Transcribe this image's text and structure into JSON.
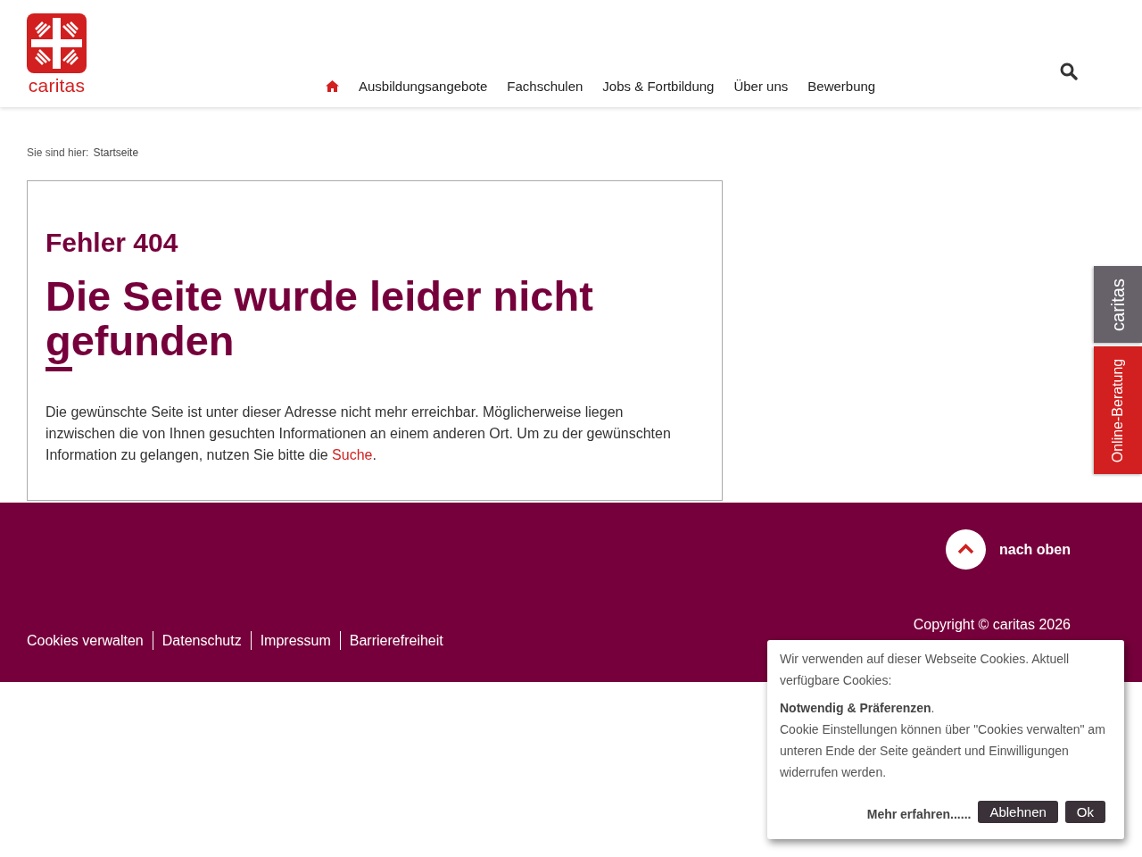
{
  "header": {
    "logo_text": "caritas",
    "nav": [
      {
        "kind": "home",
        "selected": true
      },
      {
        "kind": "link",
        "label": "Ausbildungsangebote",
        "selected": false
      },
      {
        "kind": "link",
        "label": "Fachschulen",
        "selected": false
      },
      {
        "kind": "link",
        "label": "Jobs & Fortbildung",
        "selected": false
      },
      {
        "kind": "link",
        "label": "Über uns",
        "selected": false
      },
      {
        "kind": "link",
        "label": "Bewerbung",
        "selected": false
      }
    ]
  },
  "breadcrumb": {
    "label": "Sie sind hier:",
    "current": "Startseite"
  },
  "error": {
    "code": "Fehler 404",
    "title": "Die Seite wurde leider nicht gefunden",
    "text_before": "Die gewünschte Seite ist unter dieser Adresse nicht mehr erreichbar. Möglicherweise liegen inzwischen die von Ihnen gesuchten Informationen an einem anderen Ort. Um zu der gewünschten Information zu gelangen, nutzen Sie bitte die ",
    "link": "Suche",
    "text_after": "."
  },
  "side_tabs": [
    {
      "label": "caritas",
      "color": "#67626a"
    },
    {
      "label": "Online-Beratung",
      "color": "#d21f1f"
    }
  ],
  "footer": {
    "back_to_top": "nach oben",
    "links": [
      "Cookies verwalten",
      "Datenschutz",
      "Impressum",
      "Barrierefreiheit"
    ],
    "copyright": "Copyright © caritas 2026"
  },
  "cookie_banner": {
    "intro": "Wir verwenden auf dieser Webseite Cookies. Aktuell verfügbare Cookies:",
    "categories": "**Notwendig & Präferenzen**.",
    "details": "Cookie Einstellungen können über \"Cookies verwalten\" am unteren Ende der Seite geändert und Einwilligungen widerrufen werden.",
    "more": "Mehr erfahren......",
    "buttons": [
      "Ablehnen",
      "Ok"
    ]
  }
}
